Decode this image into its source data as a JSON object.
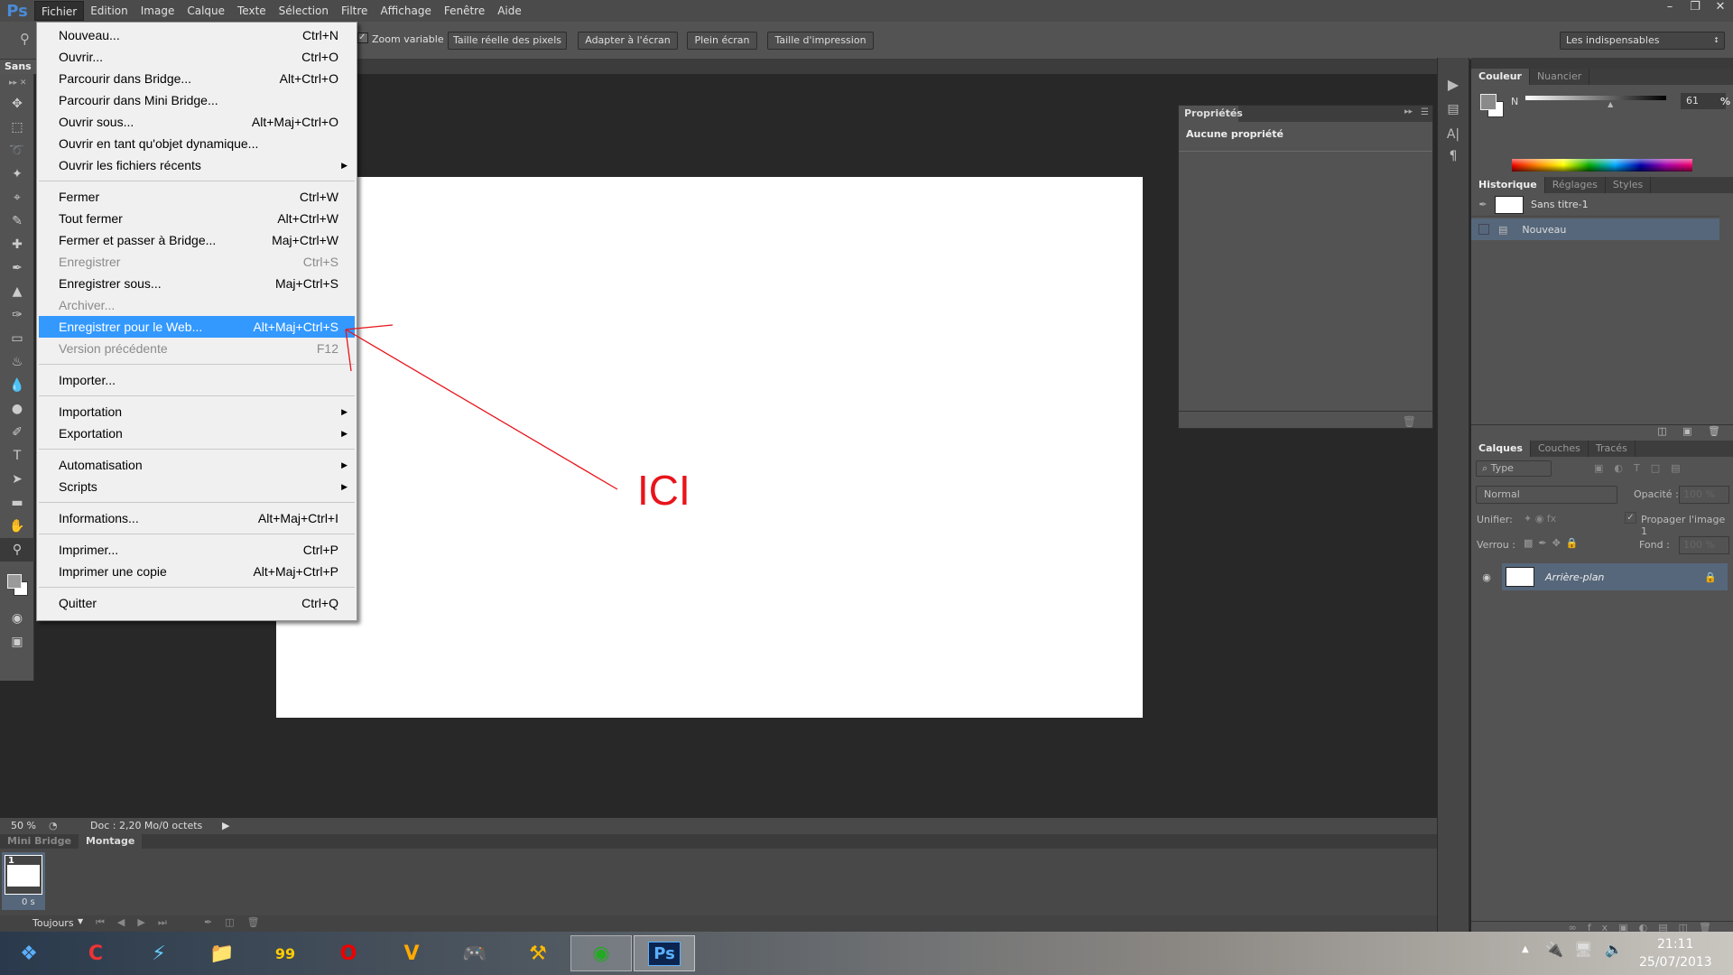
{
  "app": {
    "logo": "Ps"
  },
  "menubar": [
    "Fichier",
    "Edition",
    "Image",
    "Calque",
    "Texte",
    "Sélection",
    "Filtre",
    "Affichage",
    "Fenêtre",
    "Aide"
  ],
  "options": {
    "zoom_variable": "Zoom variable",
    "zoom_checked": true,
    "buttons": [
      "Taille réelle des pixels",
      "Adapter à l'écran",
      "Plein écran",
      "Taille d'impression"
    ],
    "workspace": "Les indispensables"
  },
  "doc_tab": "Sans",
  "file_menu": [
    {
      "label": "Nouveau...",
      "shortcut": "Ctrl+N"
    },
    {
      "label": "Ouvrir...",
      "shortcut": "Ctrl+O"
    },
    {
      "label": "Parcourir dans Bridge...",
      "shortcut": "Alt+Ctrl+O"
    },
    {
      "label": "Parcourir dans Mini Bridge...",
      "shortcut": ""
    },
    {
      "label": "Ouvrir sous...",
      "shortcut": "Alt+Maj+Ctrl+O"
    },
    {
      "label": "Ouvrir en tant qu'objet dynamique...",
      "shortcut": ""
    },
    {
      "label": "Ouvrir les fichiers récents",
      "shortcut": "",
      "submenu": true,
      "sep_after": true
    },
    {
      "label": "Fermer",
      "shortcut": "Ctrl+W"
    },
    {
      "label": "Tout fermer",
      "shortcut": "Alt+Ctrl+W"
    },
    {
      "label": "Fermer et passer à Bridge...",
      "shortcut": "Maj+Ctrl+W"
    },
    {
      "label": "Enregistrer",
      "shortcut": "Ctrl+S",
      "disabled": true
    },
    {
      "label": "Enregistrer sous...",
      "shortcut": "Maj+Ctrl+S"
    },
    {
      "label": "Archiver...",
      "shortcut": "",
      "disabled": true
    },
    {
      "label": "Enregistrer pour le Web...",
      "shortcut": "Alt+Maj+Ctrl+S",
      "highlighted": true
    },
    {
      "label": "Version précédente",
      "shortcut": "F12",
      "disabled": true,
      "sep_after": true
    },
    {
      "label": "Importer...",
      "shortcut": "",
      "sep_after": true
    },
    {
      "label": "Importation",
      "shortcut": "",
      "submenu": true
    },
    {
      "label": "Exportation",
      "shortcut": "",
      "submenu": true,
      "sep_after": true
    },
    {
      "label": "Automatisation",
      "shortcut": "",
      "submenu": true
    },
    {
      "label": "Scripts",
      "shortcut": "",
      "submenu": true,
      "sep_after": true
    },
    {
      "label": "Informations...",
      "shortcut": "Alt+Maj+Ctrl+I",
      "sep_after": true
    },
    {
      "label": "Imprimer...",
      "shortcut": "Ctrl+P"
    },
    {
      "label": "Imprimer une copie",
      "shortcut": "Alt+Maj+Ctrl+P",
      "sep_after": true
    },
    {
      "label": "Quitter",
      "shortcut": "Ctrl+Q"
    }
  ],
  "annotation": {
    "text": "ICI",
    "color": "#e8141b"
  },
  "properties": {
    "tab": "Propriétés",
    "empty": "Aucune propriété"
  },
  "color_panel": {
    "tabs": [
      "Couleur",
      "Nuancier"
    ],
    "channel": "N",
    "value": "61",
    "unit": "%",
    "slider_percent": 61
  },
  "history": {
    "tabs": [
      "Historique",
      "Réglages",
      "Styles"
    ],
    "snapshot": "Sans titre-1",
    "items": [
      "Nouveau"
    ]
  },
  "layers": {
    "tabs": [
      "Calques",
      "Couches",
      "Tracés"
    ],
    "filter": "Type",
    "blend": "Normal",
    "opacity_label": "Opacité :",
    "opacity": "100 %",
    "unify": "Unifier:",
    "propagate": "Propager l'image 1",
    "lock": "Verrou :",
    "fill_label": "Fond :",
    "fill": "100 %",
    "layer_name": "Arrière-plan"
  },
  "status": {
    "zoom": "50 %",
    "doc": "Doc : 2,20 Mo/0 octets"
  },
  "minibridge": {
    "tabs": [
      "Mini Bridge",
      "Montage"
    ],
    "frame_number": "1",
    "frame_delay": "0 s",
    "loop": "Toujours"
  },
  "taskbar": {
    "time": "21:11",
    "date": "25/07/2013"
  }
}
